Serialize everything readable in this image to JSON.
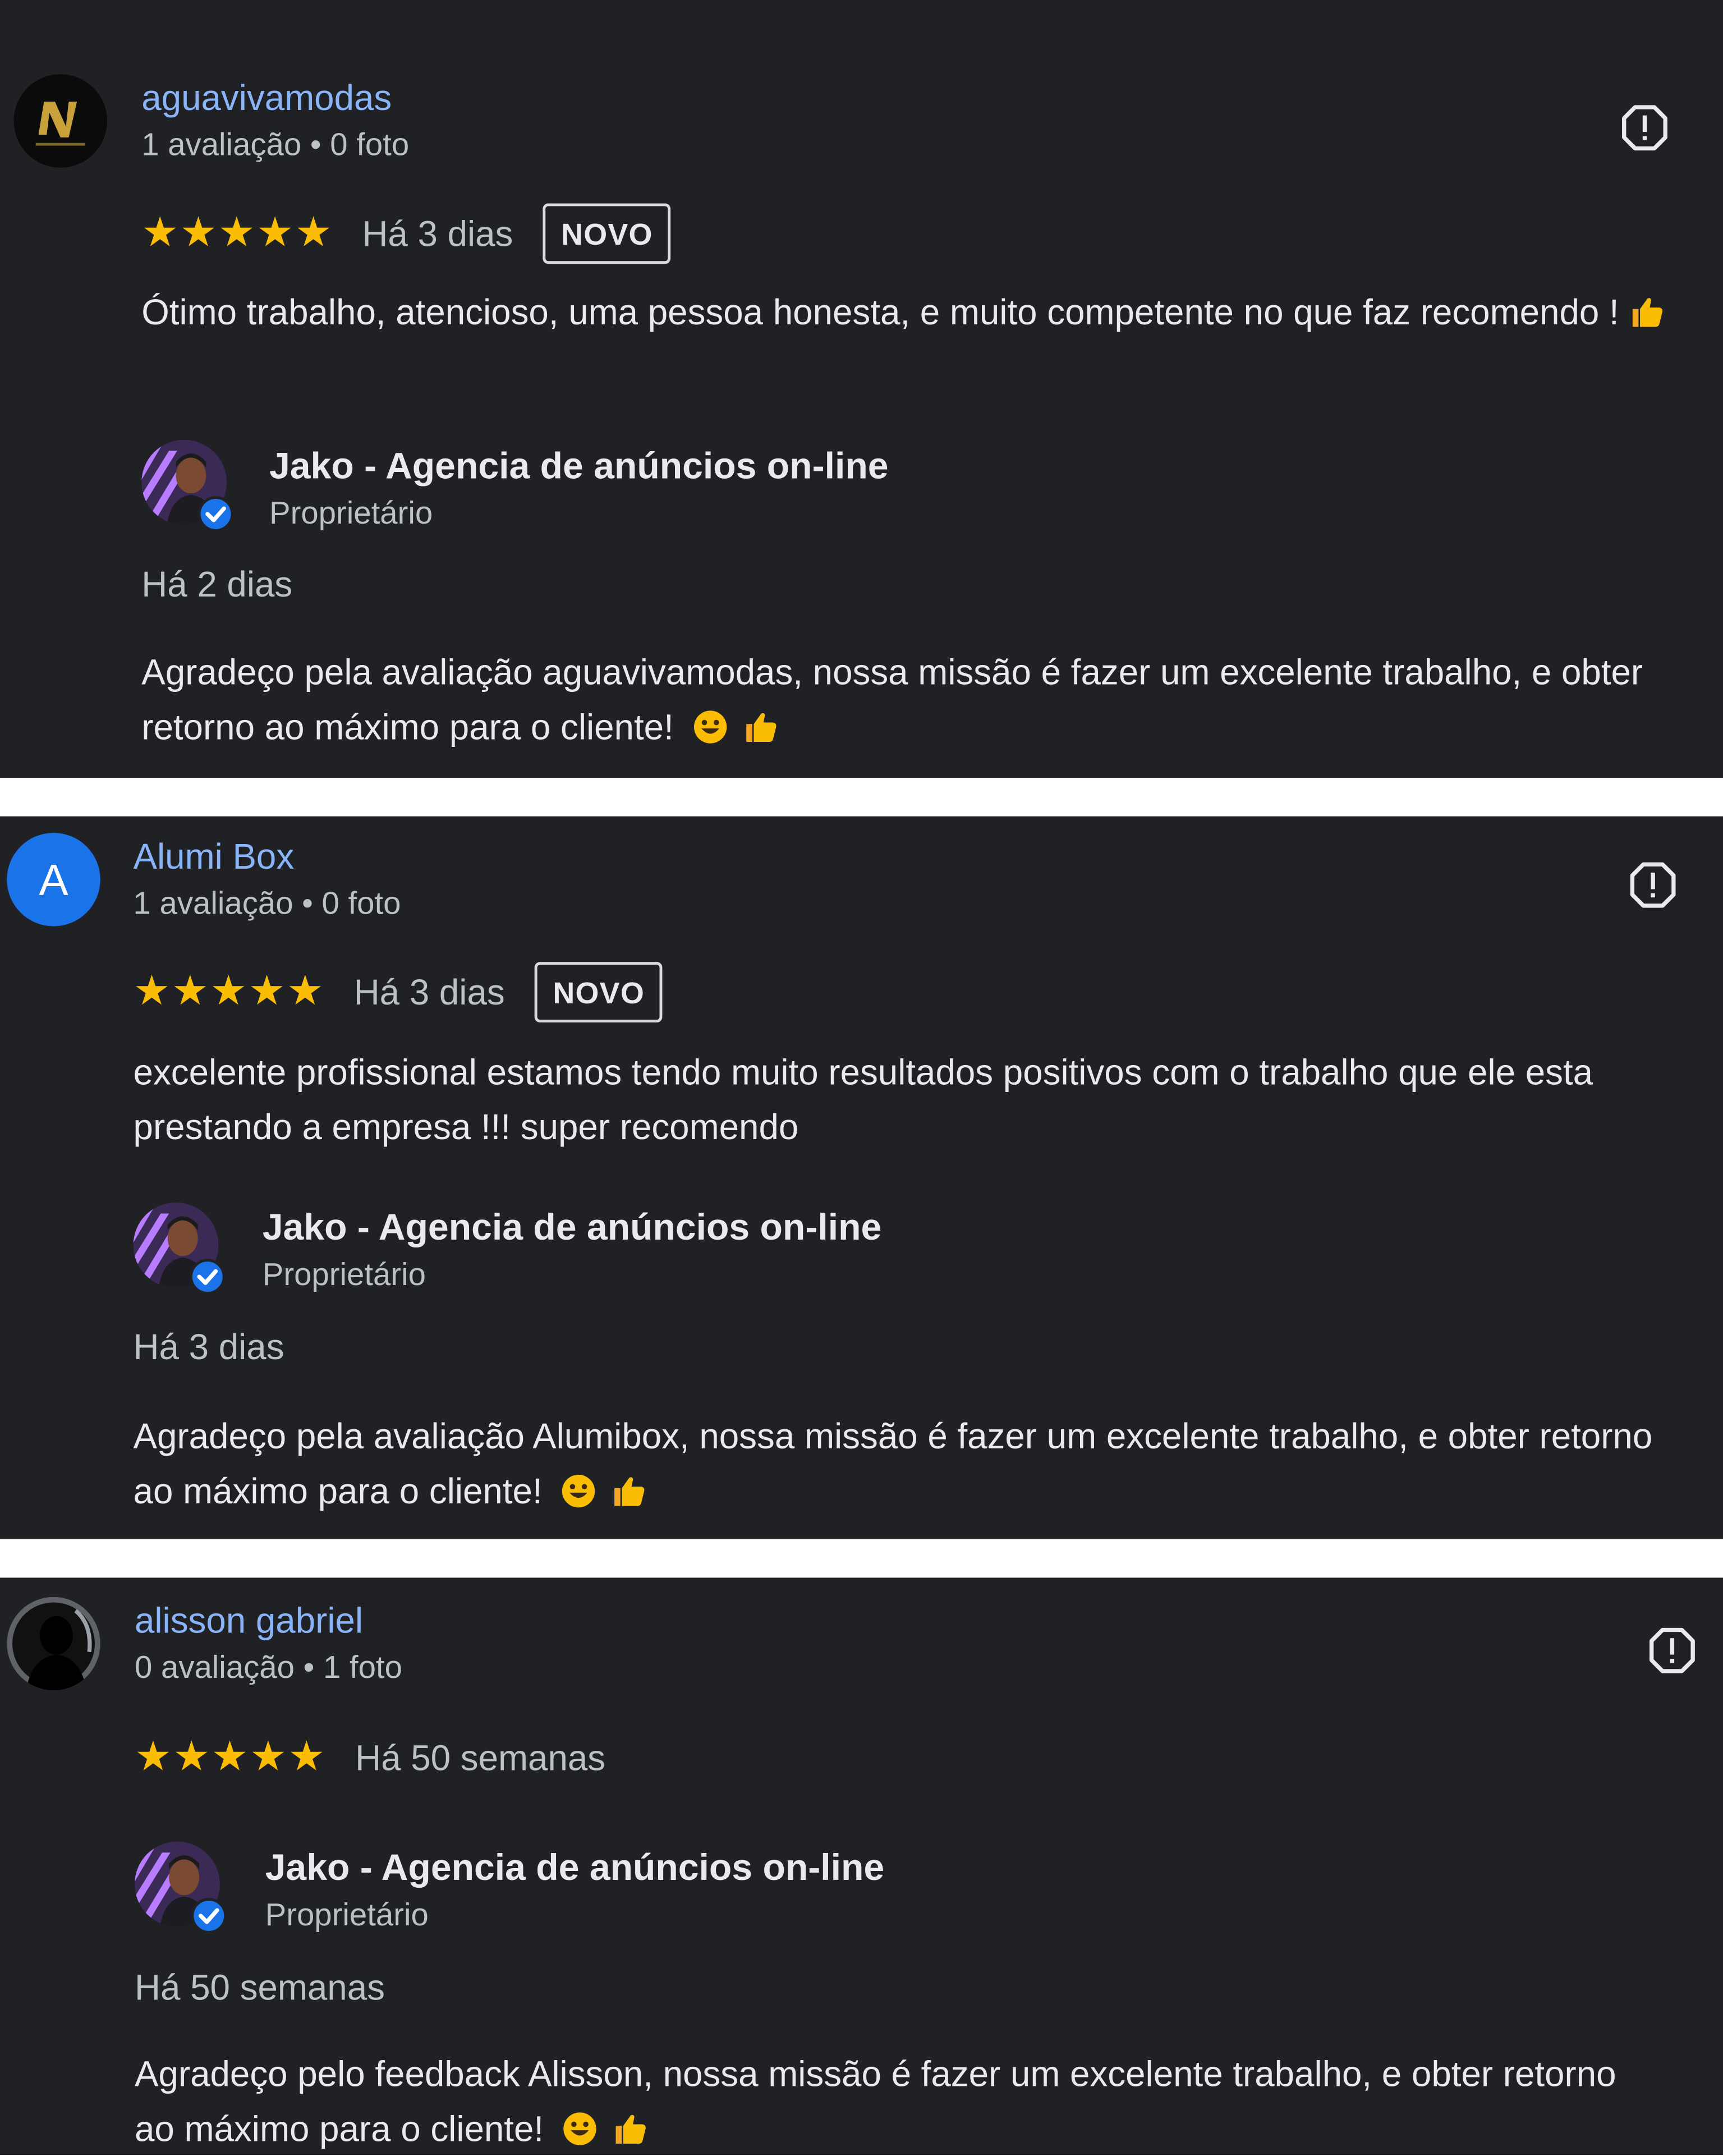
{
  "colors": {
    "background": "#202124",
    "link": "#8ab4f8",
    "star": "#fbbc04",
    "verified": "#1a73e8",
    "avatar_blue": "#1a73e8"
  },
  "reviews": [
    {
      "reviewer": "aguavivamodas",
      "meta": "1 avaliação • 0 foto",
      "avatar_icon": "brand-logo-avatar",
      "rating": 5,
      "time": "Há 3 dias",
      "badge": "NOVO",
      "text": "Ótimo trabalho, atencioso, uma pessoa honesta, e muito competente no que faz recomendo !",
      "text_emoji": "👍",
      "reply": {
        "owner": "Jako - Agencia de anúncios on-line",
        "role": "Proprietário",
        "time": "Há 2 dias",
        "text": "Agradeço pela avaliação aguavivamodas, nossa missão é fazer um excelente trabalho, e obter retorno ao máximo para o cliente!",
        "emoji": "😀 👍"
      }
    },
    {
      "reviewer": "Alumi Box",
      "meta": "1 avaliação • 0 foto",
      "avatar_letter": "A",
      "rating": 5,
      "time": "Há 3 dias",
      "badge": "NOVO",
      "text": "excelente profissional estamos tendo muito resultados positivos com o trabalho que ele esta prestando a empresa !!! super recomendo",
      "reply": {
        "owner": "Jako - Agencia de anúncios on-line",
        "role": "Proprietário",
        "time": "Há 3 dias",
        "text": "Agradeço pela avaliação Alumibox, nossa missão é fazer um excelente trabalho, e obter retorno ao máximo para o cliente!",
        "emoji": "😀 👍"
      }
    },
    {
      "reviewer": "alisson gabriel",
      "meta": "0 avaliação • 1 foto",
      "avatar_icon": "profile-photo-avatar",
      "rating": 5,
      "time": "Há 50 semanas",
      "reply": {
        "owner": "Jako - Agencia de anúncios on-line",
        "role": "Proprietário",
        "time": "Há 50 semanas",
        "text": "Agradeço pelo feedback Alisson, nossa missão é fazer um excelente trabalho, e obter retorno ao máximo para o cliente!",
        "emoji": "😀 👍"
      }
    }
  ]
}
